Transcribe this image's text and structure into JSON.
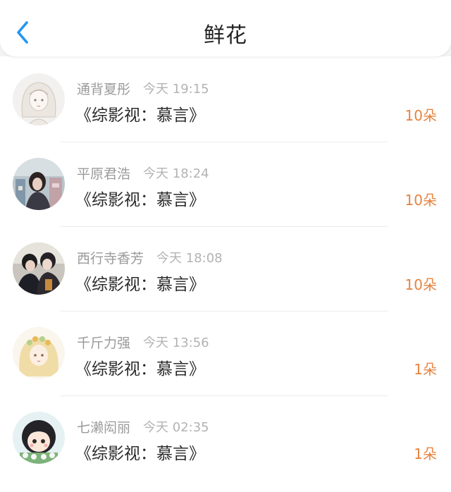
{
  "header": {
    "title": "鲜花",
    "back_icon": "chevron-left-icon",
    "accent": "#2196f3"
  },
  "list": {
    "items": [
      {
        "name": "通背夏彤",
        "time": "今天 19:15",
        "book": "《综影视：慕言》",
        "count": "10朵",
        "avatar": "anime-girl-sketch-avatar"
      },
      {
        "name": "平原君浩",
        "time": "今天 18:24",
        "book": "《综影视：慕言》",
        "count": "10朵",
        "avatar": "girl-store-photo-avatar"
      },
      {
        "name": "西行寺香芳",
        "time": "今天 18:08",
        "book": "《综影视：慕言》",
        "count": "10朵",
        "avatar": "two-boys-photo-avatar"
      },
      {
        "name": "千斤力强",
        "time": "今天 13:56",
        "book": "《综影视：慕言》",
        "count": "1朵",
        "avatar": "flower-crown-girl-avatar"
      },
      {
        "name": "七濑闳丽",
        "time": "今天 02:35",
        "book": "《综影视：慕言》",
        "count": "1朵",
        "avatar": "cartoon-child-avatar"
      }
    ]
  },
  "colors": {
    "count": "#e7833f",
    "name": "#9a9a9a",
    "book": "#2b2b2b"
  }
}
